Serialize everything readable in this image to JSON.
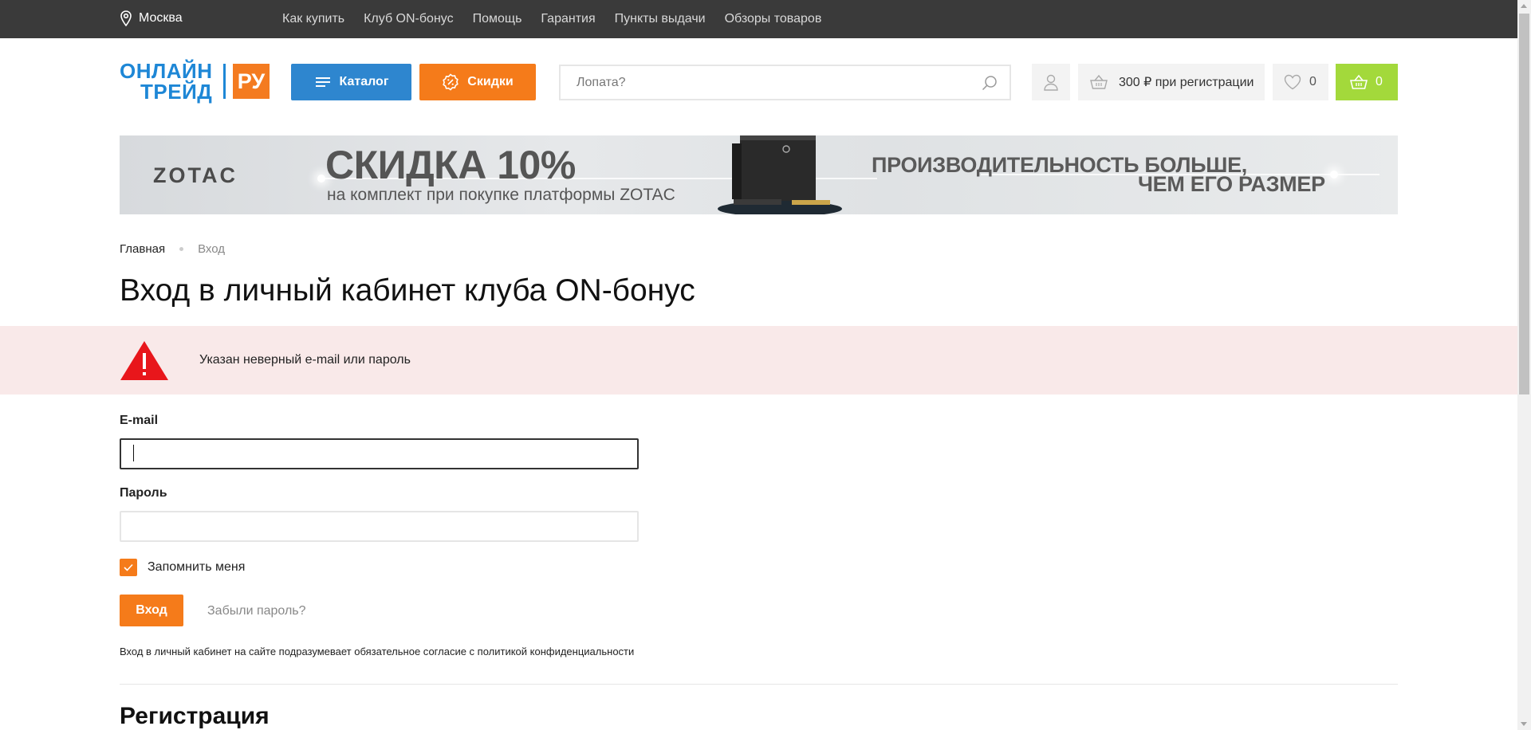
{
  "topbar": {
    "city": "Москва",
    "nav": [
      "Как купить",
      "Клуб ON-бонус",
      "Помощь",
      "Гарантия",
      "Пункты выдачи",
      "Обзоры товаров"
    ]
  },
  "header": {
    "logo": {
      "line1": "ОНЛАЙН",
      "line2": "ТРЕЙД",
      "suffix": "РУ"
    },
    "catalog_label": "Каталог",
    "sale_label": "Скидки",
    "search_placeholder": "Лопата?",
    "bonus_label": "300 ₽ при регистрации",
    "favorites_count": "0",
    "cart_count": "0"
  },
  "banner": {
    "brand": "ZOTAC",
    "headline": "СКИДКА 10%",
    "subline": "на комплект при покупке платформы ZOTAC",
    "slogan_line1": "ПРОИЗВОДИТЕЛЬНОСТЬ БОЛЬШЕ,",
    "slogan_line2": "ЧЕМ ЕГО РАЗМЕР"
  },
  "breadcrumb": {
    "home": "Главная",
    "current": "Вход"
  },
  "page_title": "Вход в личный кабинет клуба ON-бонус",
  "alert": {
    "message": "Указан неверный e-mail или пароль"
  },
  "form": {
    "email_label": "E-mail",
    "email_value": "",
    "password_label": "Пароль",
    "password_value": "",
    "remember_label": "Запомнить меня",
    "remember_checked": true,
    "login_button": "Вход",
    "forgot_link": "Забыли пароль?",
    "consent_text": "Вход в личный кабинет на сайте подразумевает обязательное согласие с политикой конфиденциальности"
  },
  "registration_title": "Регистрация",
  "colors": {
    "accent_orange": "#f57b1a",
    "accent_blue": "#2e86cf",
    "cart_green": "#a3d93b",
    "alert_bg": "#f9e9e9",
    "alert_red": "#e8161b",
    "topbar_bg": "#3a3a3a"
  }
}
